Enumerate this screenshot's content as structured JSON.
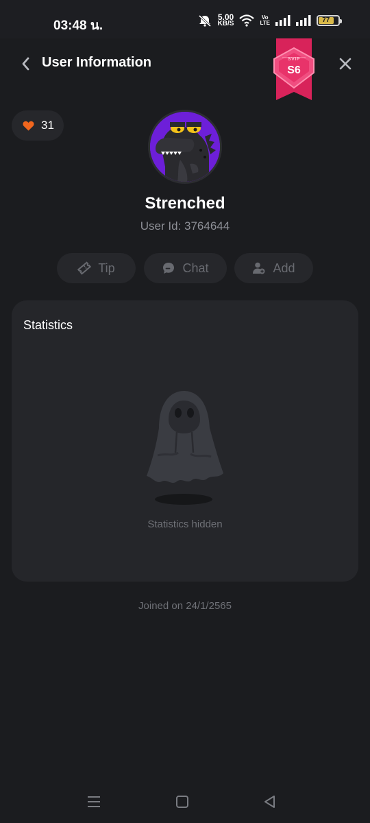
{
  "status_bar": {
    "time": "03:48 น.",
    "net_speed_value": "5.00",
    "net_speed_unit": "KB/S",
    "volte_top": "Vo",
    "volte_bottom": "LTE",
    "battery_level": "77"
  },
  "header": {
    "title": "User Information"
  },
  "svip": {
    "label": "SVIP",
    "level": "S6",
    "color": "#d8235a"
  },
  "profile": {
    "likes": "31",
    "username": "Strenched",
    "user_id": "User Id: 3764644"
  },
  "actions": {
    "tip": "Tip",
    "chat": "Chat",
    "add": "Add"
  },
  "statistics": {
    "title": "Statistics",
    "hidden_text": "Statistics hidden"
  },
  "footer": {
    "joined": "Joined on 24/1/2565"
  },
  "colors": {
    "background": "#1b1c1f",
    "card": "#25262a",
    "accent_heart": "#f0661e",
    "muted_text": "#6f7177"
  }
}
